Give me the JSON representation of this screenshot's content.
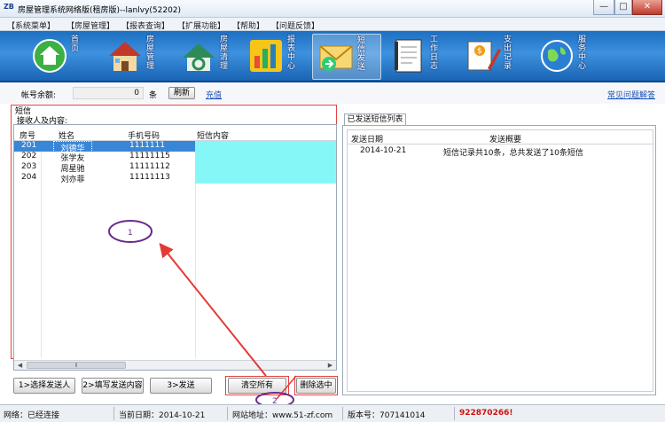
{
  "window": {
    "title": "房屋管理系统网络版(租房版)--lanlvy(52202)",
    "minimize": "—",
    "maximize": "□",
    "close": "✕"
  },
  "menu": [
    "【系统菜单】",
    "【房屋管理】",
    "【报表查询】",
    "【扩展功能】",
    "【帮助】",
    "【问题反馈】"
  ],
  "toolbar": [
    {
      "label": "首页",
      "icon": "home-icon"
    },
    {
      "label": "房屋管理",
      "icon": "house-icon"
    },
    {
      "label": "房屋清理",
      "icon": "recycle-icon"
    },
    {
      "label": "报表中心",
      "icon": "chart-icon"
    },
    {
      "label": "短信发送",
      "icon": "envelope-icon"
    },
    {
      "label": "工作日志",
      "icon": "notebook-icon"
    },
    {
      "label": "支出记录",
      "icon": "expense-icon"
    },
    {
      "label": "服务中心",
      "icon": "globe-icon"
    }
  ],
  "account": {
    "label": "帐号余额:",
    "balance": "0",
    "unit": "条",
    "refresh": "刷新",
    "recharge": "充值",
    "faq": "常见问题解答"
  },
  "sms": {
    "group_title": "短信",
    "recipients_title": "接收人及内容:",
    "columns": [
      "房号",
      "姓名",
      "手机号码",
      "短信内容"
    ],
    "rows": [
      {
        "room": "201",
        "name": "刘德华",
        "phone": "1111111",
        "content": ""
      },
      {
        "room": "202",
        "name": "张学友",
        "phone": "11111115",
        "content": ""
      },
      {
        "room": "203",
        "name": "周星驰",
        "phone": "11111112",
        "content": ""
      },
      {
        "room": "204",
        "name": "刘亦菲",
        "phone": "11111113",
        "content": ""
      }
    ],
    "scroll_grip": "⦀",
    "scroll_left": "◀",
    "scroll_right": "▶"
  },
  "actions": {
    "step1": "1>选择发送人",
    "step2": "2>填写发送内容",
    "step3": "3>发送",
    "clear_all": "清空所有",
    "delete_selected": "删除选中"
  },
  "sent": {
    "tab": "已发送短信列表",
    "columns": [
      "发送日期",
      "发送概要"
    ],
    "rows": [
      {
        "date": "2014-10-21",
        "summary": "短信记录共10条，总共发送了10条短信"
      }
    ]
  },
  "annotations": {
    "marker1": "1",
    "marker2": "2"
  },
  "status": {
    "network": "网络：已经连接",
    "date": "当前日期：2014-10-21",
    "site": "网站地址：www.51-zf.com",
    "version": "版本号：707141014",
    "phone": "922870266!"
  },
  "colors": {
    "toolbar_blue": "#1d6fc1",
    "selection_blue": "#3a86d6",
    "cyan_cell": "#86f7f7",
    "highlight_red": "#e04444",
    "annotation_purple": "#6a2a8c"
  }
}
